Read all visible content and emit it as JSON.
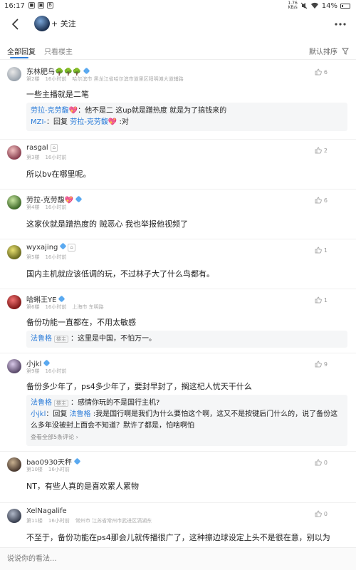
{
  "status_bar": {
    "time": "16:17",
    "net_speed_top": "1.76",
    "net_speed_unit": "KB/s",
    "battery": "14%"
  },
  "header": {
    "follow_label": "+ 关注"
  },
  "tabs": {
    "all": "全部回复",
    "op_only": "只看楼主",
    "sort": "默认排序"
  },
  "comments": [
    {
      "name": "东林肥鸟🌳🌳🌳",
      "floor": "第2楼",
      "time": "16小时前",
      "location": "哈尔滨市 黑龙江省哈尔滨市道里区阳明滩大道辅路",
      "likes": "6",
      "text": "一些主播就是二笔",
      "replies": [
        {
          "user": "劳拉-克劳馥💖",
          "sep": "：",
          "text": "他不是二 这up就是蹭热度 就是为了搞钱来的"
        },
        {
          "user": "MZI-",
          "sep": "：回复 ",
          "target": "劳拉-克劳馥💖",
          "text": " :对"
        }
      ]
    },
    {
      "name": "rasgal",
      "floor": "第3楼",
      "time": "16小时前",
      "likes": "2",
      "text": "所以bv在哪里呢。"
    },
    {
      "name": "劳拉-克劳馥💖",
      "floor": "第4楼",
      "time": "16小时前",
      "likes": "6",
      "text": "这家伙就是蹭热度的 贼恶心 我也举报他视频了"
    },
    {
      "name": "wyxajing",
      "floor": "第5楼",
      "time": "16小时前",
      "likes": "1",
      "text": "国内主机就应该低调的玩，不过林子大了什么鸟都有。"
    },
    {
      "name": "哈蝌王YE",
      "floor": "第6楼",
      "time": "16小时前",
      "location": "上海市 东明路",
      "likes": "1",
      "text": "备份功能一直都在，不用太敏感",
      "replies": [
        {
          "user": "法鲁格",
          "badge": "楼主",
          "sep": "：",
          "text": "这里是中国，不怕万一。"
        }
      ]
    },
    {
      "name": "小jkl",
      "floor": "第9楼",
      "time": "16小时前",
      "likes": "9",
      "text": "备份多少年了，ps4多少年了，要封早封了，搁这杞人忧天干什么",
      "replies": [
        {
          "user": "法鲁格",
          "badge": "楼主",
          "sep": "：",
          "text": "感情你玩的不是国行主机?"
        },
        {
          "user": "小jkl",
          "sep": "：回复 ",
          "target": "法鲁格",
          "text": " :我是国行啊是我们为什么要怕这个啊，这又不是按键后门什么的，说了备份这么多年没被封上面会不知道？默许了都是，怕啥啊怕"
        }
      ],
      "more": "查看全部5条评论 ›"
    },
    {
      "name": "bao0930天秤",
      "floor": "第10楼",
      "time": "16小时前",
      "likes": "0",
      "text": "NT，有些人真的是喜欢累人累物"
    },
    {
      "name": "XelNagalife",
      "floor": "第11楼",
      "time": "16小时前",
      "location": "常州市 江苏省常州市武进区滆湖东",
      "likes": "0",
      "text": "不至于，备份功能在ps4那会儿就传播很广了，这种擦边球设定上头不是很在意，别以为"
    }
  ],
  "input": {
    "placeholder": "说说你的看法..."
  },
  "colors": {
    "accent": "#2b7cd9",
    "reply_bg": "#f5f6f7"
  }
}
